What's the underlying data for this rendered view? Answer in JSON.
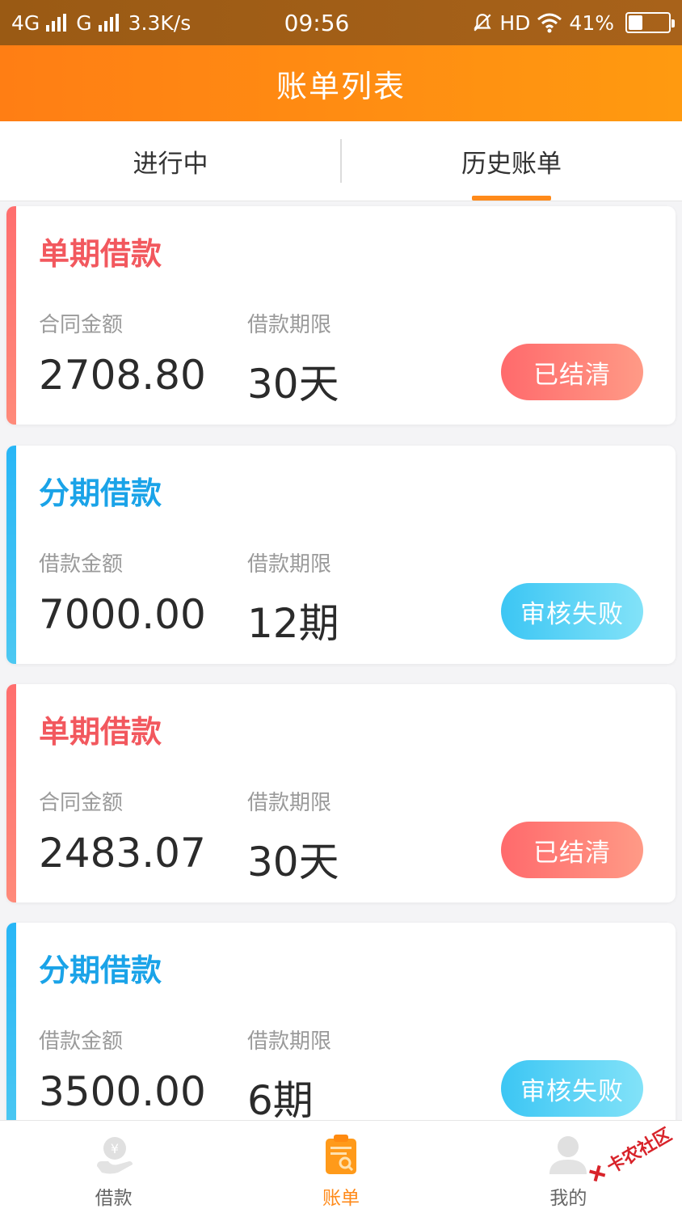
{
  "status_bar": {
    "net1": "4G",
    "net2": "G",
    "speed": "3.3K/s",
    "time": "09:56",
    "hd": "HD",
    "battery": "41%",
    "battery_level": 0.41
  },
  "header": {
    "title": "账单列表"
  },
  "tabs": [
    {
      "label": "进行中",
      "active": false
    },
    {
      "label": "历史账单",
      "active": true
    }
  ],
  "bills": [
    {
      "type": "单期借款",
      "amount_label": "合同金额",
      "amount": "2708.80",
      "term_label": "借款期限",
      "term": "30天",
      "status": "已结清",
      "theme": "red"
    },
    {
      "type": "分期借款",
      "amount_label": "借款金额",
      "amount": "7000.00",
      "term_label": "借款期限",
      "term": "12期",
      "status": "审核失败",
      "theme": "blue"
    },
    {
      "type": "单期借款",
      "amount_label": "合同金额",
      "amount": "2483.07",
      "term_label": "借款期限",
      "term": "30天",
      "status": "已结清",
      "theme": "red"
    },
    {
      "type": "分期借款",
      "amount_label": "借款金额",
      "amount": "3500.00",
      "term_label": "借款期限",
      "term": "6期",
      "status": "审核失败",
      "theme": "blue"
    }
  ],
  "nav": [
    {
      "label": "借款",
      "icon": "loan-icon",
      "active": false
    },
    {
      "label": "账单",
      "icon": "bill-icon",
      "active": true
    },
    {
      "label": "我的",
      "icon": "user-icon",
      "active": false
    }
  ],
  "watermark": "卡农社区",
  "colors": {
    "accent_orange": "#ff8a1a",
    "single_red": "#f2585e",
    "installment_blue": "#1aa3e8"
  }
}
